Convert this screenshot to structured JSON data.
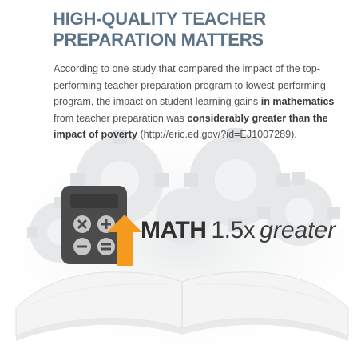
{
  "heading": {
    "line1": "HIGH-QUALITY TEACHER",
    "line2": "PREPARATION MATTERS"
  },
  "paragraph": {
    "part1": "According to one study that compared the impact of the top-performing teacher preparation program to lowest-performing program, the impact on student learning gains ",
    "bold1": "in mathematics",
    "part2": " from teacher preparation was ",
    "bold2": "considerably greater than the impact of poverty",
    "part3": " (http://eric.ed.gov/?id=EJ1007289)."
  },
  "stat": {
    "subject": "MATH",
    "multiplier": "1.5x",
    "comparison": "greater"
  },
  "icons": {
    "calculator": "calculator-icon",
    "arrow": "up-arrow-icon",
    "book": "open-book-icon",
    "gears": "gears-icon"
  },
  "colors": {
    "heading": "#5b7287",
    "text": "#4f4f4f",
    "arrow": "#f39a1f",
    "calculator": "#4b4b4b"
  }
}
